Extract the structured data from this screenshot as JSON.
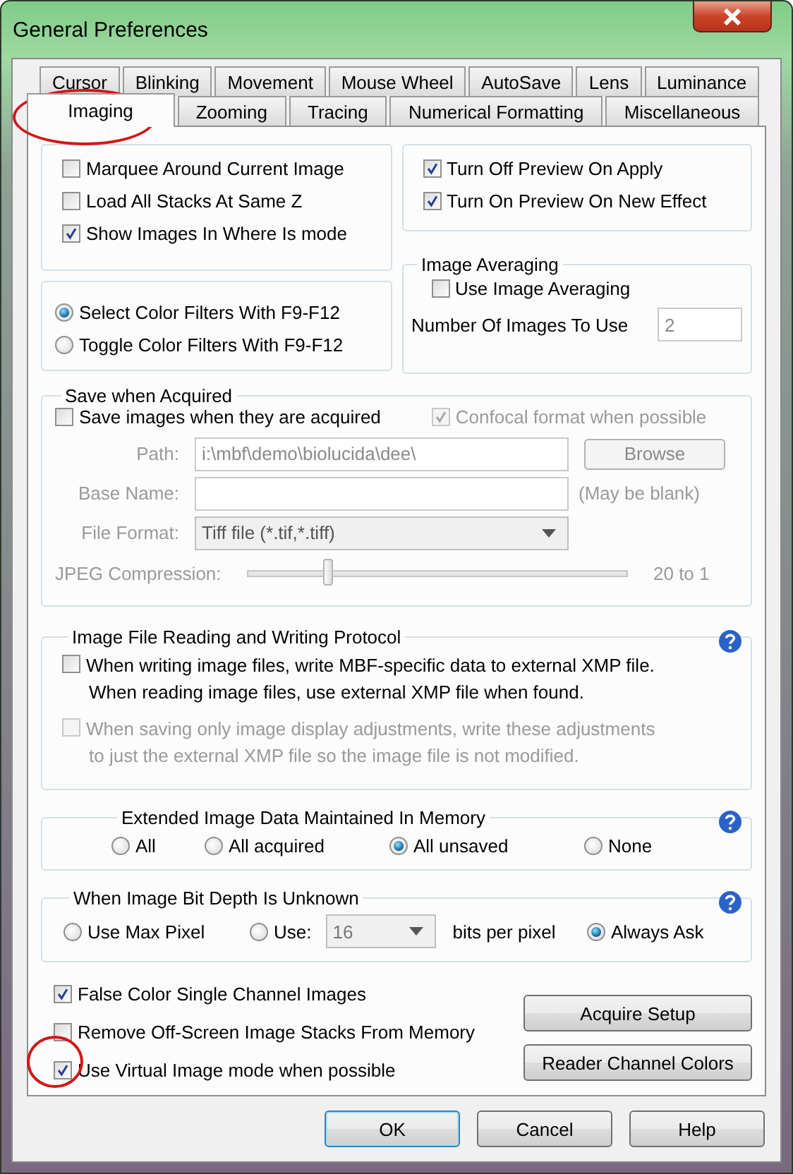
{
  "window": {
    "title": "General Preferences"
  },
  "tab_rows": [
    [
      {
        "label": "Cursor",
        "selected": false
      },
      {
        "label": "Blinking",
        "selected": false
      },
      {
        "label": "Movement",
        "selected": false
      },
      {
        "label": "Mouse Wheel",
        "selected": false
      },
      {
        "label": "AutoSave",
        "selected": false
      },
      {
        "label": "Lens",
        "selected": false
      },
      {
        "label": "Luminance",
        "selected": false
      }
    ],
    [
      {
        "label": "Imaging",
        "selected": true
      },
      {
        "label": "Zooming",
        "selected": false
      },
      {
        "label": "Tracing",
        "selected": false
      },
      {
        "label": "Numerical Formatting",
        "selected": false
      },
      {
        "label": "Miscellaneous",
        "selected": false
      }
    ]
  ],
  "display_options": [
    {
      "label": "Marquee Around Current Image",
      "checked": false
    },
    {
      "label": "Load All Stacks At Same Z",
      "checked": false
    },
    {
      "label": "Show Images In Where Is mode",
      "checked": true
    }
  ],
  "color_filters": [
    {
      "label": "Select Color Filters With F9-F12",
      "selected": true
    },
    {
      "label": "Toggle Color Filters With F9-F12",
      "selected": false
    }
  ],
  "preview_options": [
    {
      "label": "Turn Off Preview On Apply",
      "checked": true
    },
    {
      "label": "Turn On Preview On New Effect",
      "checked": true
    }
  ],
  "image_averaging": {
    "title": "Image Averaging",
    "checkbox": {
      "label": "Use Image Averaging",
      "checked": false
    },
    "count_label": "Number Of Images To Use",
    "count_value": "2"
  },
  "save_when_acquired": {
    "title": "Save when Acquired",
    "save_checkbox": {
      "label": "Save images when they are acquired",
      "checked": false
    },
    "confocal_checkbox": {
      "label": "Confocal format when possible",
      "checked": true,
      "disabled": true
    },
    "path": {
      "label": "Path:",
      "value": "i:\\mbf\\demo\\biolucida\\dee\\",
      "disabled": true
    },
    "browse_button": "Browse",
    "base_name": {
      "label": "Base Name:",
      "note": "(May be blank)",
      "disabled": true
    },
    "file_format": {
      "label": "File Format:",
      "value": "Tiff file (*.tif,*.tiff)",
      "disabled": true
    },
    "jpeg": {
      "label": "JPEG Compression:",
      "level": 0.21,
      "reading": "20 to 1",
      "disabled": true
    }
  },
  "xmp": {
    "title": "Image File Reading and Writing Protocol",
    "options": [
      {
        "lines": [
          "When writing image files, write MBF-specific data to external XMP file.",
          "When reading image files, use external XMP file when found."
        ],
        "checked": false,
        "disabled": false
      },
      {
        "lines": [
          "When saving only image display adjustments, write these adjustments",
          "to just the external XMP file so the image file is not modified."
        ],
        "checked": false,
        "disabled": true
      }
    ]
  },
  "extended": {
    "title": "Extended Image Data Maintained In Memory",
    "options": [
      {
        "label": "All",
        "selected": false
      },
      {
        "label": "All acquired",
        "selected": false
      },
      {
        "label": "All unsaved",
        "selected": true
      },
      {
        "label": "None",
        "selected": false
      }
    ]
  },
  "bit_depth": {
    "title": "When Image Bit Depth Is Unknown",
    "use_max": {
      "label": "Use Max Pixel",
      "selected": false
    },
    "use": {
      "label": "Use:",
      "selected": false,
      "value": "16",
      "unit": "bits per pixel"
    },
    "always_ask": {
      "label": "Always Ask",
      "selected": true
    }
  },
  "bottom_options": [
    {
      "label": "False Color Single Channel Images",
      "checked": true
    },
    {
      "label": "Remove Off-Screen Image Stacks From Memory",
      "checked": false
    },
    {
      "label": "Use Virtual Image mode when possible",
      "checked": true
    }
  ],
  "side_buttons": [
    "Acquire Setup",
    "Reader Channel Colors"
  ],
  "buttons": [
    {
      "label": "OK",
      "default": true
    },
    {
      "label": "Cancel",
      "default": false
    },
    {
      "label": "Help",
      "default": false
    }
  ]
}
